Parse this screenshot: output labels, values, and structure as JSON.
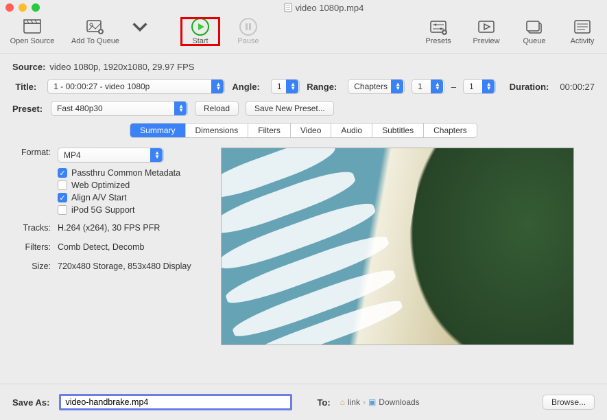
{
  "window": {
    "title": "video 1080p.mp4"
  },
  "toolbar": {
    "open_source": "Open Source",
    "add_to_queue": "Add To Queue",
    "start": "Start",
    "pause": "Pause",
    "presets": "Presets",
    "preview": "Preview",
    "queue": "Queue",
    "activity": "Activity"
  },
  "source": {
    "label": "Source:",
    "value": "video 1080p, 1920x1080, 29.97 FPS"
  },
  "title_row": {
    "label": "Title:",
    "value": "1 - 00:00:27 - video 1080p",
    "angle_label": "Angle:",
    "angle_value": "1",
    "range_label": "Range:",
    "range_mode": "Chapters",
    "range_from": "1",
    "range_sep": "–",
    "range_to": "1",
    "duration_label": "Duration:",
    "duration_value": "00:00:27"
  },
  "preset": {
    "label": "Preset:",
    "value": "Fast 480p30",
    "reload": "Reload",
    "save_new": "Save New Preset..."
  },
  "tabs": [
    "Summary",
    "Dimensions",
    "Filters",
    "Video",
    "Audio",
    "Subtitles",
    "Chapters"
  ],
  "summary": {
    "format_label": "Format:",
    "format_value": "MP4",
    "checks": {
      "passthru": {
        "label": "Passthru Common Metadata",
        "on": true
      },
      "weboptimized": {
        "label": "Web Optimized",
        "on": false
      },
      "alignav": {
        "label": "Align A/V Start",
        "on": true
      },
      "ipod5g": {
        "label": "iPod 5G Support",
        "on": false
      }
    },
    "tracks_label": "Tracks:",
    "tracks_value": "H.264 (x264), 30 FPS PFR",
    "filters_label": "Filters:",
    "filters_value": "Comb Detect, Decomb",
    "size_label": "Size:",
    "size_value": "720x480 Storage, 853x480 Display"
  },
  "footer": {
    "save_as_label": "Save As:",
    "save_as_value": "video-handbrake.mp4",
    "to_label": "To:",
    "path": [
      "link",
      "Downloads"
    ],
    "browse": "Browse..."
  }
}
